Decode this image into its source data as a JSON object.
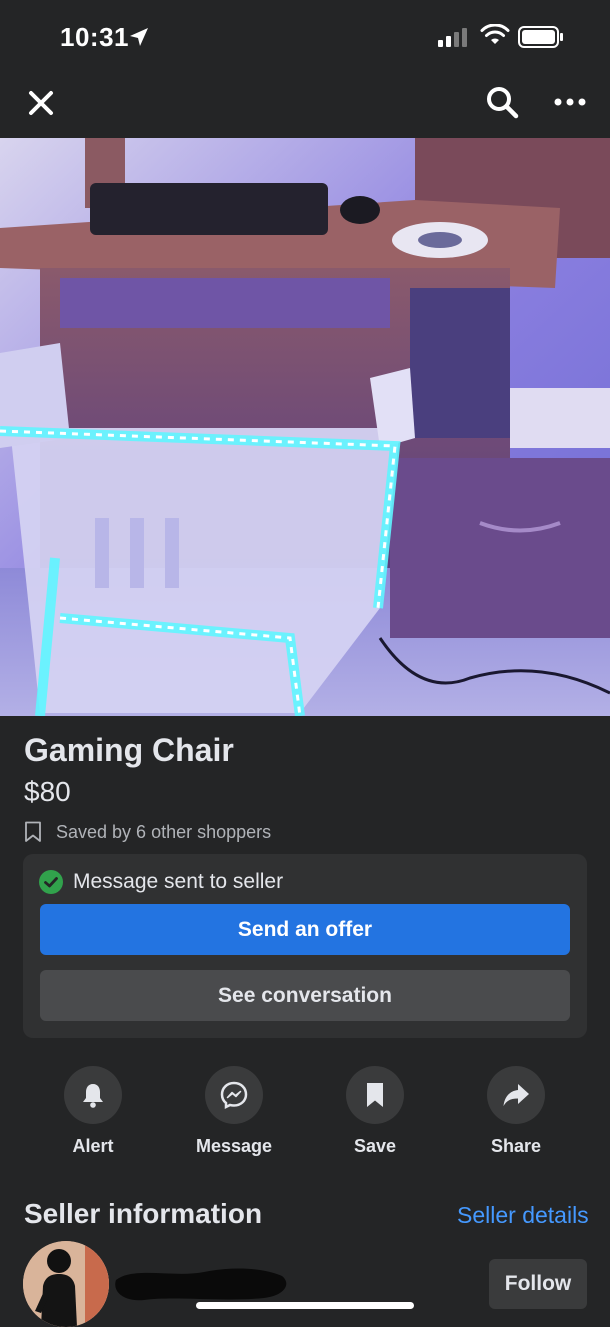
{
  "status_bar": {
    "time": "10:31",
    "icons": [
      "location-arrow-icon",
      "signal-icon",
      "wifi-icon",
      "battery-icon"
    ]
  },
  "nav": {
    "icons": [
      "close-icon",
      "search-icon",
      "more-icon"
    ]
  },
  "listing": {
    "title": "Gaming Chair",
    "price": "$80",
    "saved_text": "Saved by 6 other shoppers"
  },
  "message_card": {
    "status": "Message sent to seller",
    "primary_label": "Send an offer",
    "secondary_label": "See conversation"
  },
  "actions": [
    {
      "label": "Alert",
      "icon": "bell-icon"
    },
    {
      "label": "Message",
      "icon": "messenger-icon"
    },
    {
      "label": "Save",
      "icon": "bookmark-icon"
    },
    {
      "label": "Share",
      "icon": "share-icon"
    }
  ],
  "seller": {
    "heading": "Seller information",
    "details_link": "Seller details",
    "follow_label": "Follow"
  },
  "colors": {
    "background": "#242526",
    "primary_button": "#2374e1",
    "link": "#4599ff",
    "success": "#31a24c"
  }
}
